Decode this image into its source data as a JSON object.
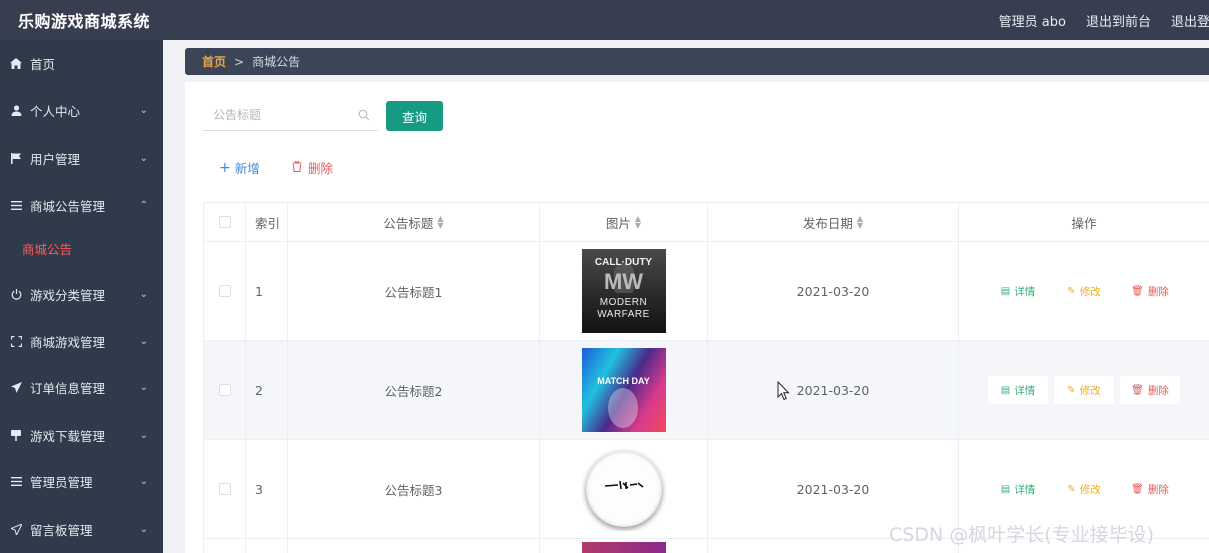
{
  "header": {
    "app_title": "乐购游戏商城系统",
    "admin_label": "管理员 abo",
    "back_front_label": "退出到前台",
    "logout_label": "退出登录"
  },
  "sidebar": {
    "items": [
      {
        "label": "首页",
        "icon": "home-icon"
      },
      {
        "label": "个人中心",
        "icon": "user-icon"
      },
      {
        "label": "用户管理",
        "icon": "flag-icon"
      },
      {
        "label": "商城公告管理",
        "icon": "menu-lines-icon"
      },
      {
        "label": "游戏分类管理",
        "icon": "power-icon"
      },
      {
        "label": "商城游戏管理",
        "icon": "fullscreen-icon"
      },
      {
        "label": "订单信息管理",
        "icon": "send-icon"
      },
      {
        "label": "游戏下载管理",
        "icon": "download-icon"
      },
      {
        "label": "管理员管理",
        "icon": "menu-lines-icon"
      },
      {
        "label": "留言板管理",
        "icon": "send-icon"
      }
    ],
    "active_submenu": "商城公告",
    "accent_color": "#ff5b5b"
  },
  "breadcrumb": {
    "home": "首页",
    "separator": ">",
    "current": "商城公告"
  },
  "search": {
    "placeholder": "公告标题",
    "button_label": "查询"
  },
  "actions": {
    "add_label": "新增",
    "delete_label": "删除"
  },
  "table": {
    "columns": {
      "index": "索引",
      "title": "公告标题",
      "image": "图片",
      "date": "发布日期",
      "ops": "操作"
    },
    "op_labels": {
      "detail": "详情",
      "edit": "修改",
      "delete": "删除"
    },
    "thumb1": {
      "line1": "CALL·DUTY",
      "line2": "MW",
      "line3": "MODERN",
      "line4": "WARFARE"
    },
    "thumb2": {
      "line1": "MATCH DAY"
    },
    "rows": [
      {
        "index": "1",
        "title": "公告标题1",
        "date": "2021-03-20",
        "image": "call-of-duty-modern-warfare-cover"
      },
      {
        "index": "2",
        "title": "公告标题2",
        "date": "2021-03-20",
        "image": "match-day-cover"
      },
      {
        "index": "3",
        "title": "公告标题3",
        "date": "2021-03-20",
        "image": "calligraphy-logo-cover"
      }
    ]
  },
  "watermark": "CSDN @枫叶学长(专业接毕设)"
}
